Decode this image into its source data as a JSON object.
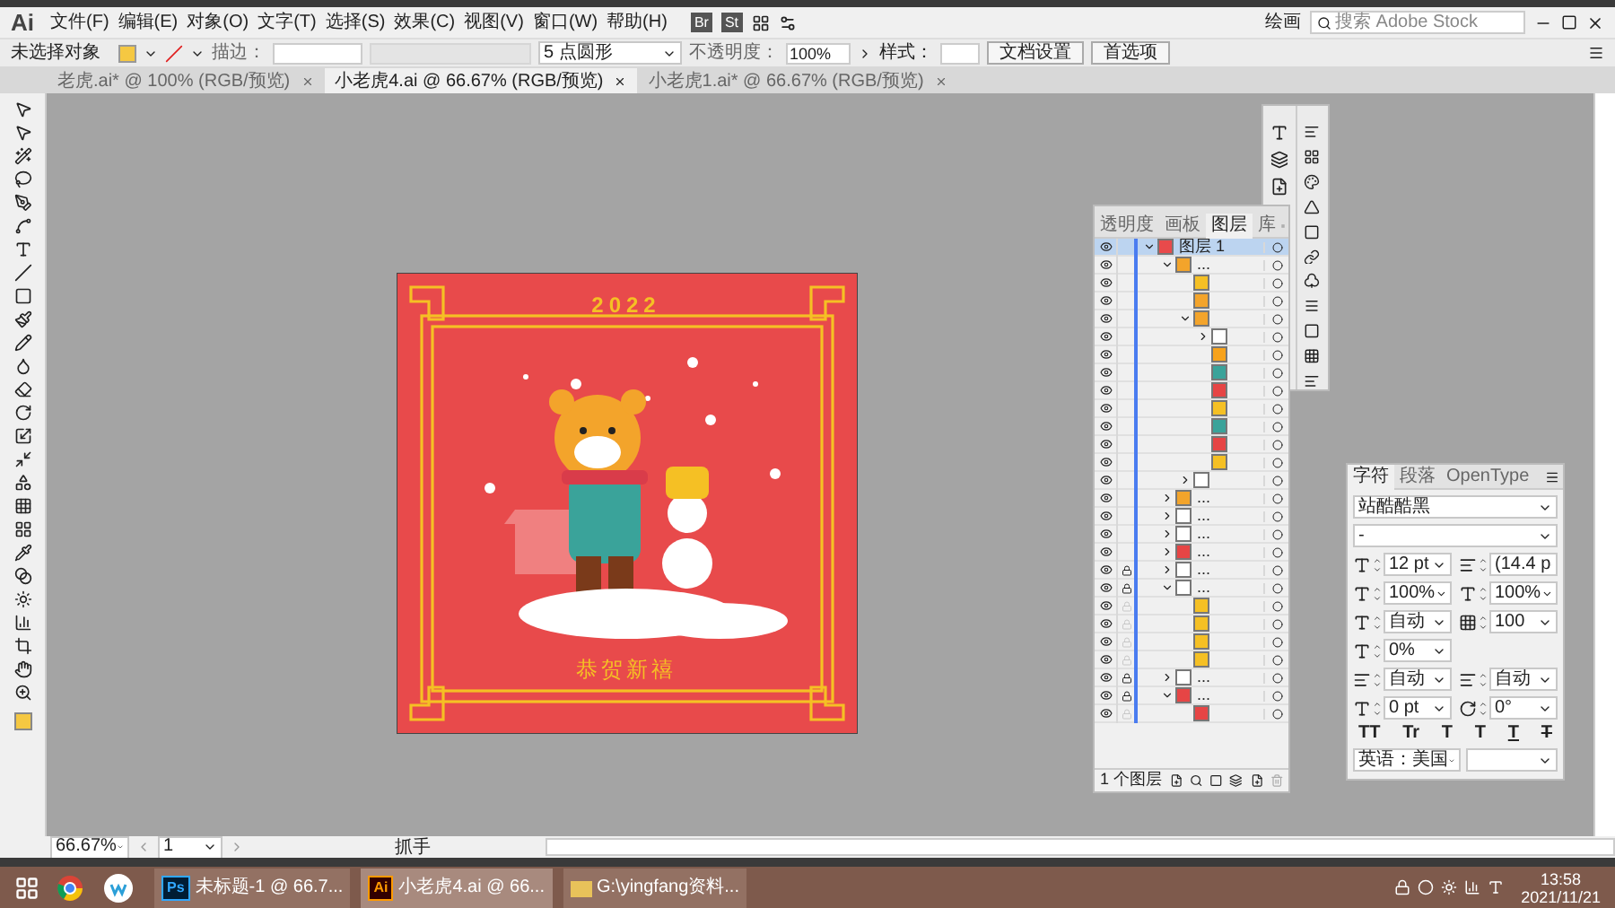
{
  "app": {
    "logo": "Ai",
    "menus": [
      "文件(F)",
      "编辑(E)",
      "对象(O)",
      "文字(T)",
      "选择(S)",
      "效果(C)",
      "视图(V)",
      "窗口(W)",
      "帮助(H)"
    ],
    "bridge": "Br",
    "stock": "St",
    "workspace": "绘画",
    "search_placeholder": "搜索 Adobe Stock"
  },
  "control_bar": {
    "selection": "未选择对象",
    "stroke_label": "描边：",
    "brush": "5 点圆形",
    "opacity_label": "不透明度：",
    "opacity": "100%",
    "style_label": "样式：",
    "buttons": [
      "文档设置",
      "首选项"
    ]
  },
  "tabs": [
    {
      "label": "老虎.ai* @ 100% (RGB/预览)",
      "selected": false
    },
    {
      "label": "小老虎4.ai @ 66.67% (RGB/预览)",
      "selected": true
    },
    {
      "label": "小老虎1.ai* @ 66.67% (RGB/预览)",
      "selected": false
    }
  ],
  "artwork": {
    "year": "2022",
    "greeting": "恭贺新禧"
  },
  "layers_panel": {
    "tabs": [
      {
        "label": "透明度",
        "selected": false
      },
      {
        "label": "画板",
        "selected": false
      },
      {
        "label": "图层",
        "selected": true
      },
      {
        "label": "库",
        "selected": false
      }
    ],
    "layers": [
      {
        "name": "图层 1",
        "color": "#e84a4b",
        "visible": true,
        "locked": false,
        "selected": true,
        "expanded": true,
        "children": [
          {
            "name": "...",
            "color": "#f3a42b",
            "visible": true,
            "locked": false,
            "selected": false,
            "expanded": true,
            "children": [
              {
                "color": "#f5c024",
                "visible": true,
                "locked": false,
                "selected": false
              },
              {
                "color": "#f3a42b",
                "visible": true,
                "locked": false,
                "selected": false
              },
              {
                "color": "#f3a42b",
                "visible": true,
                "locked": false,
                "selected": false,
                "expanded": true,
                "children": [
                  {
                    "color": "#ffffff",
                    "visible": true,
                    "locked": false,
                    "selected": false,
                    "expanded": false
                  },
                  {
                    "color": "#f7a21b",
                    "visible": true,
                    "locked": false,
                    "selected": false
                  },
                  {
                    "color": "#3aa39a",
                    "visible": true,
                    "locked": false,
                    "selected": false
                  },
                  {
                    "color": "#e64545",
                    "visible": true,
                    "locked": false,
                    "selected": false
                  },
                  {
                    "color": "#f5c024",
                    "visible": true,
                    "locked": false,
                    "selected": false
                  },
                  {
                    "color": "#3aa39a",
                    "visible": true,
                    "locked": false,
                    "selected": false
                  },
                  {
                    "color": "#e64545",
                    "visible": true,
                    "locked": false,
                    "selected": false
                  },
                  {
                    "color": "#f5c024",
                    "visible": true,
                    "locked": false,
                    "selected": false
                  }
                ]
              },
              {
                "color": "#ffffff",
                "visible": true,
                "locked": false,
                "selected": false,
                "expanded": false
              }
            ]
          },
          {
            "name": "...",
            "color": "#f3a42b",
            "visible": true,
            "locked": false,
            "selected": false,
            "expanded": false
          },
          {
            "name": "...",
            "color": "#ffffff",
            "visible": true,
            "locked": false,
            "selected": false,
            "expanded": false
          },
          {
            "name": "...",
            "color": "#ffffff",
            "visible": true,
            "locked": false,
            "selected": false,
            "expanded": false
          },
          {
            "name": "...",
            "color": "#e64545",
            "visible": true,
            "locked": false,
            "selected": false,
            "expanded": false
          },
          {
            "name": "...",
            "color": "#ffffff",
            "visible": true,
            "locked": true,
            "selected": false,
            "expanded": false
          },
          {
            "name": "...",
            "color": "#ffffff",
            "visible": true,
            "locked": true,
            "selected": false,
            "expanded": true,
            "children": [
              {
                "color": "#f5c024",
                "visible": true,
                "locked": false,
                "selected": false
              },
              {
                "color": "#f5c024",
                "visible": true,
                "locked": false,
                "selected": false
              },
              {
                "color": "#f5c024",
                "visible": true,
                "locked": false,
                "selected": false
              },
              {
                "color": "#f5c024",
                "visible": true,
                "locked": false,
                "selected": false
              }
            ]
          },
          {
            "name": "...",
            "color": "#ffffff",
            "visible": true,
            "locked": true,
            "selected": false,
            "expanded": false
          },
          {
            "name": "...",
            "color": "#e64545",
            "visible": true,
            "locked": true,
            "selected": false,
            "expanded": true,
            "children": [
              {
                "color": "#e64545",
                "visible": true,
                "locked": false,
                "selected": false
              }
            ]
          }
        ]
      }
    ],
    "count": "1 个图层"
  },
  "character_panel": {
    "tabs": [
      {
        "label": "字符",
        "selected": true
      },
      {
        "label": "段落",
        "selected": false
      },
      {
        "label": "OpenType",
        "selected": false
      }
    ],
    "font": "站酷酷黑",
    "style": "-",
    "size": "12 pt",
    "leading": "(14.4 p",
    "vscale": "100%",
    "hscale": "100%",
    "kerning": "自动",
    "tracking": "100",
    "tsume": "0%",
    "aki_left": "自动",
    "aki_right": "自动",
    "baseline": "0 pt",
    "rotation": "0°",
    "formats": [
      {
        "label": "TT",
        "kind": "plain"
      },
      {
        "label": "Tr",
        "kind": "plain"
      },
      {
        "label": "T",
        "kind": "super"
      },
      {
        "label": "T",
        "kind": "sub"
      },
      {
        "label": "T",
        "kind": "underline"
      },
      {
        "label": "T",
        "kind": "strike"
      }
    ],
    "language": "英语：美国"
  },
  "status_bar": {
    "zoom": "66.67%",
    "artboard": "1",
    "tool": "抓手"
  },
  "taskbar": {
    "apps": [
      {
        "label": "未标题-1 @ 66.7...",
        "kind": "ps",
        "badge": "Ps",
        "selected": false
      },
      {
        "label": "小老虎4.ai @ 66...",
        "kind": "ai",
        "badge": "Ai",
        "selected": true
      },
      {
        "label": "G:\\yingfang资料...",
        "kind": "folder",
        "selected": false
      }
    ],
    "time": "13:58",
    "date": "2021/11/21"
  }
}
